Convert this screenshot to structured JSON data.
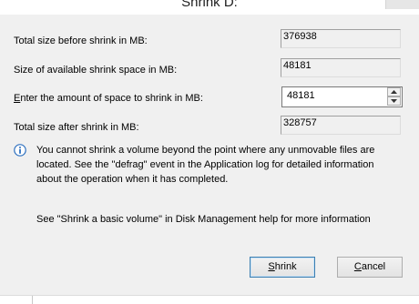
{
  "window": {
    "title": "Shrink D:"
  },
  "fields": {
    "total_size_label": "Total size before shrink in MB:",
    "total_size_value": "376938",
    "available_label": "Size of available shrink space in MB:",
    "available_value": "48181",
    "amount_label_prefix": "",
    "amount_label_mnemonic": "E",
    "amount_label_rest": "nter the amount of space to shrink in MB:",
    "amount_value": "48181",
    "after_label": "Total size after shrink in MB:",
    "after_value": "328757"
  },
  "info": {
    "message": "You cannot shrink a volume beyond the point where any unmovable files are located. See the \"defrag\" event in the Application log for detailed information about the operation when it has completed.",
    "help": "See \"Shrink a basic volume\" in Disk Management help for more information"
  },
  "buttons": {
    "shrink_mnemonic": "S",
    "shrink_rest": "hrink",
    "cancel_mnemonic": "C",
    "cancel_rest": "ancel"
  },
  "icons": {
    "info": "info-icon",
    "spin_up": "up-arrow-icon",
    "spin_down": "down-arrow-icon",
    "close": "close-icon"
  },
  "colors": {
    "dialog_bg": "#f0f0f0",
    "info_icon_blue": "#2c6fbf",
    "default_button_border": "#3c7fb1"
  }
}
